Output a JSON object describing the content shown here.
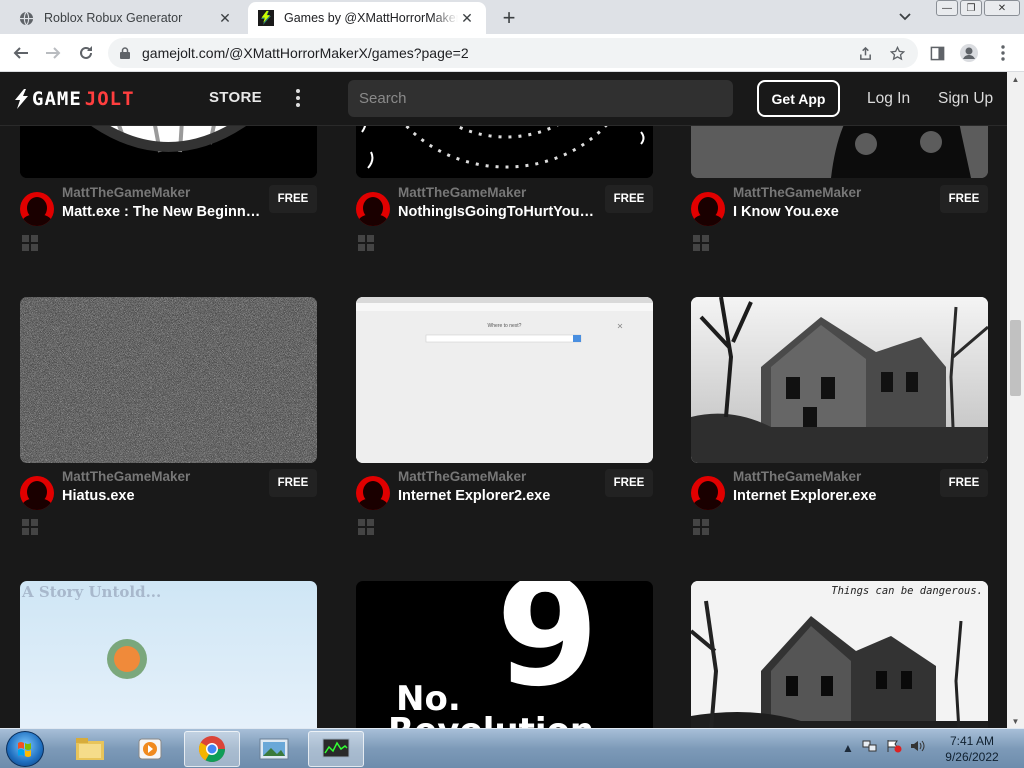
{
  "browser": {
    "tabs": [
      {
        "title": "Roblox Robux Generator",
        "active": false
      },
      {
        "title": "Games by @XMattHorrorMakerX",
        "active": true
      }
    ],
    "new_tab_symbol": "+",
    "close_symbol": "✕",
    "url": "gamejolt.com/@XMattHorrorMakerX/games?page=2",
    "window_buttons": {
      "minimize": "—",
      "maximize": "❐",
      "close": "✕"
    }
  },
  "site": {
    "logo_left": "GAME",
    "logo_right": "JOLT",
    "store_label": "STORE",
    "search_placeholder": "Search",
    "get_app_label": "Get App",
    "login_label": "Log In",
    "signup_label": "Sign Up",
    "colors": {
      "header_bg": "#191919",
      "accent_red": "#ff3e3e",
      "card_badge_bg": "#222222"
    }
  },
  "games": [
    {
      "author": "MattTheGameMaker",
      "title": "Matt.exe : The New Beginning",
      "price": "FREE",
      "thumb": "smile-face"
    },
    {
      "author": "MattTheGameMaker",
      "title": "NothingIsGoingToHurtYou.exe",
      "price": "FREE",
      "thumb": "tunnel"
    },
    {
      "author": "MattTheGameMaker",
      "title": "I Know You.exe",
      "price": "FREE",
      "thumb": "creature"
    },
    {
      "author": "MattTheGameMaker",
      "title": "Hiatus.exe",
      "price": "FREE",
      "thumb": "static-noise"
    },
    {
      "author": "MattTheGameMaker",
      "title": "Internet Explorer2.exe",
      "price": "FREE",
      "thumb": "browser-page",
      "thumb_text": "Where to next?"
    },
    {
      "author": "MattTheGameMaker",
      "title": "Internet Explorer.exe",
      "price": "FREE",
      "thumb": "abandoned-house"
    },
    {
      "author": "",
      "title": "",
      "price": "",
      "thumb": "story-untold",
      "thumb_text": "A Story Untold..."
    },
    {
      "author": "",
      "title": "",
      "price": "",
      "thumb": "no9-revolution",
      "thumb_text": "9",
      "thumb_text2": "No.",
      "thumb_text3": "Revolution"
    },
    {
      "author": "",
      "title": "",
      "price": "",
      "thumb": "house-dangerous",
      "thumb_text": "Things can be dangerous."
    }
  ],
  "taskbar": {
    "apps": [
      "explorer-icon",
      "media-player-icon",
      "chrome-icon",
      "photo-viewer-icon",
      "task-manager-icon"
    ],
    "time": "7:41 AM",
    "date": "9/26/2022"
  }
}
